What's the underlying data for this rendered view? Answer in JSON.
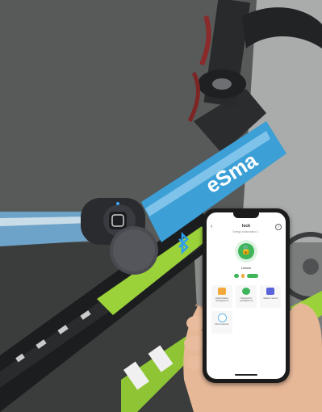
{
  "photo": {
    "description_icon": "bluetooth-icon",
    "colors": {
      "wall": "#5a5c5b",
      "strap": "#3c9fd6",
      "frame_green": "#9bd23a",
      "lock_body": "#2e2f33"
    },
    "strap_text": "eSma"
  },
  "app": {
    "title": "lock",
    "subtitle": "Energy consumption ☐",
    "lock_state": "Unlock",
    "accent": "#3fb55a",
    "tiles": [
      {
        "label": "Authorization management",
        "icon": "people-icon",
        "color": "#f2a93b"
      },
      {
        "label": "Fingerprint management",
        "icon": "fingerprint-icon",
        "color": "#3fb55a"
      },
      {
        "label": "Station record",
        "icon": "record-icon",
        "color": "#5a64d8"
      },
      {
        "label": "More features",
        "icon": "more-icon",
        "color": "#6ab6e8"
      }
    ]
  }
}
